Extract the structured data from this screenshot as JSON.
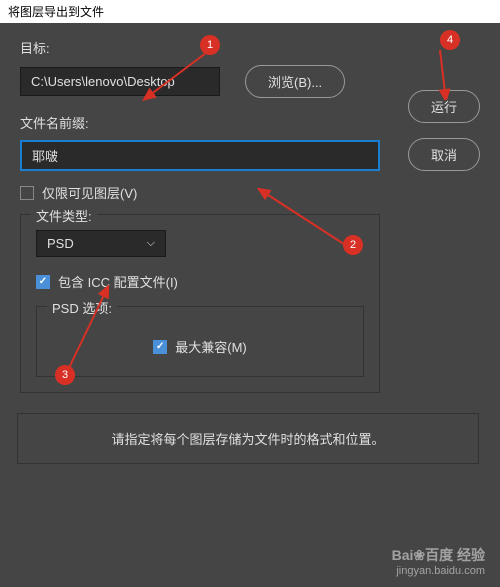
{
  "window": {
    "title": "将图层导出到文件"
  },
  "target": {
    "label": "目标:",
    "path": "C:\\Users\\lenovo\\Desktop",
    "browse": "浏览(B)..."
  },
  "prefix": {
    "label": "文件名前缀:",
    "value": "耶啵"
  },
  "visibleOnly": {
    "label": "仅限可见图层(V)"
  },
  "fileType": {
    "label": "文件类型:",
    "value": "PSD",
    "icc": "包含 ICC 配置文件(I)",
    "psdOptions": {
      "label": "PSD 选项:",
      "maxCompat": "最大兼容(M)"
    }
  },
  "actions": {
    "run": "运行",
    "cancel": "取消"
  },
  "info": "请指定将每个图层存储为文件时的格式和位置。",
  "markers": {
    "m1": "1",
    "m2": "2",
    "m3": "3",
    "m4": "4"
  },
  "watermark": {
    "logo": "Bai❀百度 经验",
    "url": "jingyan.baidu.com"
  }
}
